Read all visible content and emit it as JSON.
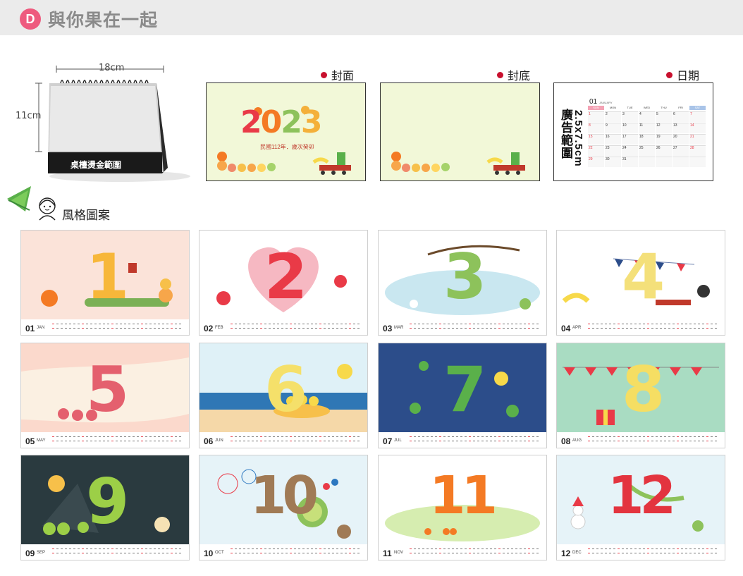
{
  "header": {
    "badge": "D",
    "title": "與你果在一起"
  },
  "stand": {
    "width_label": "18cm",
    "height_label": "11cm",
    "band_text": "桌檯燙金範圍"
  },
  "mockups": {
    "cover": {
      "label": "封面",
      "year": "2023",
      "subtitle": "民國112年．歲次癸卯"
    },
    "back": {
      "label": "封底"
    },
    "date": {
      "label": "日期",
      "month_num": "01",
      "month_name": "JANUARY",
      "weekdays": [
        "SUN",
        "MON",
        "TUE",
        "WED",
        "THU",
        "FRI",
        "SAT"
      ],
      "weeks": [
        [
          "1",
          "2",
          "3",
          "4",
          "5",
          "6",
          "7"
        ],
        [
          "8",
          "9",
          "10",
          "11",
          "12",
          "13",
          "14"
        ],
        [
          "15",
          "16",
          "17",
          "18",
          "19",
          "20",
          "21"
        ],
        [
          "22",
          "23",
          "24",
          "25",
          "26",
          "27",
          "28"
        ],
        [
          "29",
          "30",
          "31",
          "",
          "",
          "",
          ""
        ]
      ],
      "ad_size": "2.5x7.5cm",
      "ad_text": "廣告範圍"
    }
  },
  "style_section": {
    "label": "風格圖案"
  },
  "months": [
    {
      "num": "01",
      "abbr": "JAN",
      "digit": "1",
      "bg": "#fbe3d9",
      "digit_color": "#f7b73a"
    },
    {
      "num": "02",
      "abbr": "FEB",
      "digit": "2",
      "bg": "#ffffff",
      "digit_color": "#e93a47"
    },
    {
      "num": "03",
      "abbr": "MAR",
      "digit": "3",
      "bg": "#ffffff",
      "digit_color": "#8dc25b"
    },
    {
      "num": "04",
      "abbr": "APR",
      "digit": "4",
      "bg": "#ffffff",
      "digit_color": "#f4e07a"
    },
    {
      "num": "05",
      "abbr": "MAY",
      "digit": "5",
      "bg": "#fbd9cc",
      "digit_color": "#e4606e"
    },
    {
      "num": "06",
      "abbr": "JUN",
      "digit": "6",
      "bg": "#dff1f7",
      "digit_color": "#f5e06a"
    },
    {
      "num": "07",
      "abbr": "JUL",
      "digit": "7",
      "bg": "#2c4d8a",
      "digit_color": "#5ab04a"
    },
    {
      "num": "08",
      "abbr": "AUG",
      "digit": "8",
      "bg": "#a9dcc2",
      "digit_color": "#f5de63"
    },
    {
      "num": "09",
      "abbr": "SEP",
      "digit": "9",
      "bg": "#2a3a3f",
      "digit_color": "#9ccf47"
    },
    {
      "num": "10",
      "abbr": "OCT",
      "digit": "10",
      "bg": "#e6f3f8",
      "digit_color": "#a07a55"
    },
    {
      "num": "11",
      "abbr": "NOV",
      "digit": "11",
      "bg": "#ffffff",
      "digit_color": "#f47a24"
    },
    {
      "num": "12",
      "abbr": "DEC",
      "digit": "12",
      "bg": "#e6f3f8",
      "digit_color": "#e3343f"
    }
  ],
  "colors": {
    "accent": "#ee5a7e",
    "dot": "#c8102e",
    "cover_bg": "#f2f8d8"
  }
}
